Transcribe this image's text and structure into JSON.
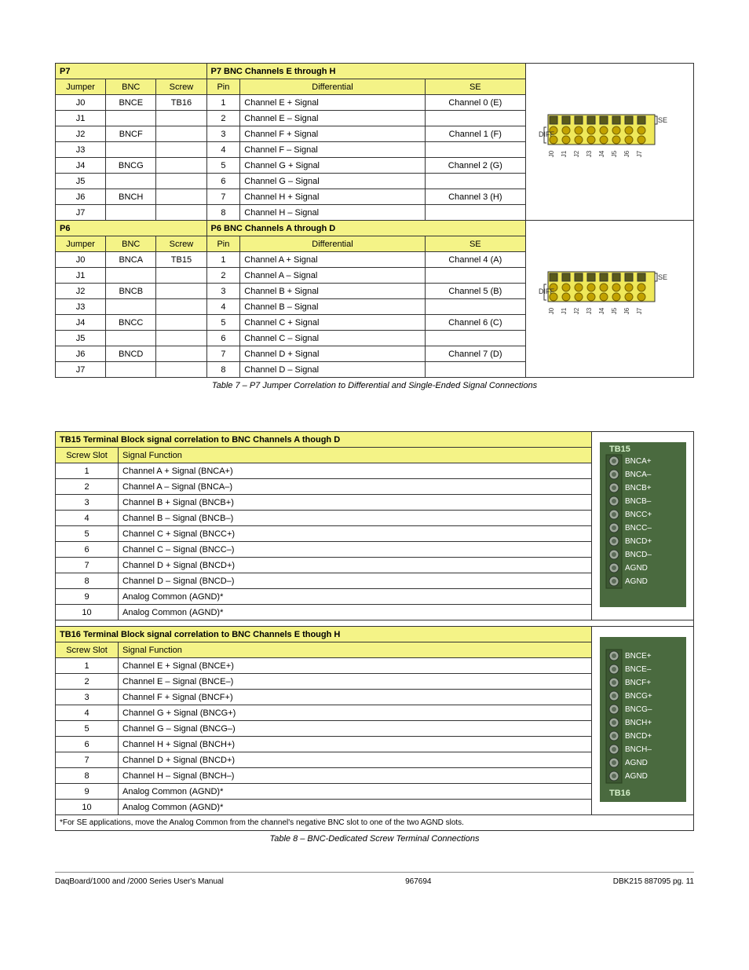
{
  "tables": {
    "p7": {
      "caption": "Table 7 – P7 Jumper Correlation to Differential and Single-Ended Signal Connections",
      "sections": [
        {
          "block_hdr": "P7 BNC Channels E through H",
          "cols": [
            "Jumper",
            "BNC",
            "Screw",
            "Pin",
            "Differential",
            "SE"
          ],
          "rows": [
            [
              "J0",
              "BNCE",
              "TB16",
              "1",
              "Channel E + Signal",
              "Channel 0 (E)"
            ],
            [
              "J1",
              "",
              "",
              "2",
              "Channel E – Signal",
              ""
            ],
            [
              "J2",
              "BNCF",
              "",
              "3",
              "Channel F + Signal",
              "Channel 1 (F)"
            ],
            [
              "J3",
              "",
              "",
              "4",
              "Channel F – Signal",
              ""
            ],
            [
              "J4",
              "BNCG",
              "",
              "5",
              "Channel G + Signal",
              "Channel 2 (G)"
            ],
            [
              "J5",
              "",
              "",
              "6",
              "Channel G – Signal",
              ""
            ],
            [
              "J6",
              "BNCH",
              "",
              "7",
              "Channel H + Signal",
              "Channel 3 (H)"
            ],
            [
              "J7",
              "",
              "",
              "8",
              "Channel H – Signal",
              ""
            ]
          ],
          "image_label": "P7"
        },
        {
          "block_hdr": "P6 BNC Channels A through D",
          "cols": [
            "Jumper",
            "BNC",
            "Screw",
            "Pin",
            "Differential",
            "SE"
          ],
          "rows": [
            [
              "J0",
              "BNCA",
              "TB15",
              "1",
              "Channel A + Signal",
              "Channel 4 (A)"
            ],
            [
              "J1",
              "",
              "",
              "2",
              "Channel A – Signal",
              ""
            ],
            [
              "J2",
              "BNCB",
              "",
              "3",
              "Channel B + Signal",
              "Channel 5 (B)"
            ],
            [
              "J3",
              "",
              "",
              "4",
              "Channel B – Signal",
              ""
            ],
            [
              "J4",
              "BNCC",
              "",
              "5",
              "Channel C + Signal",
              "Channel 6 (C)"
            ],
            [
              "J5",
              "",
              "",
              "6",
              "Channel C – Signal",
              ""
            ],
            [
              "J6",
              "BNCD",
              "",
              "7",
              "Channel D + Signal",
              "Channel 7 (D)"
            ],
            [
              "J7",
              "",
              "",
              "8",
              "Channel D – Signal",
              ""
            ]
          ],
          "image_label": "P6"
        }
      ]
    },
    "tb": {
      "caption": "Table 8 – BNC-Dedicated Screw Terminal Connections",
      "sections": [
        {
          "block_hdr": "TB15 Terminal Block signal correlation to BNC Channels A though D",
          "cols": [
            "Screw Slot",
            "Signal Function"
          ],
          "rows": [
            [
              "1",
              "Channel A + Signal (BNCA+)"
            ],
            [
              "2",
              "Channel A – Signal (BNCA–)"
            ],
            [
              "3",
              "Channel B + Signal (BNCB+)"
            ],
            [
              "4",
              "Channel B – Signal (BNCB–)"
            ],
            [
              "5",
              "Channel C + Signal (BNCC+)"
            ],
            [
              "6",
              "Channel C – Signal (BNCC–)"
            ],
            [
              "7",
              "Channel D + Signal (BNCD+)"
            ],
            [
              "8",
              "Channel D – Signal (BNCD–)"
            ],
            [
              "9",
              "Analog Common (AGND)*"
            ],
            [
              "10",
              "Analog Common (AGND)*"
            ]
          ],
          "tb_label": "TB15",
          "pins": [
            "BNCA+",
            "BNCA–",
            "BNCB+",
            "BNCB–",
            "BNCC+",
            "BNCC–",
            "BNCD+",
            "BNCD–",
            "AGND",
            "AGND"
          ]
        },
        {
          "block_hdr": "TB16 Terminal Block signal correlation to BNC Channels E though H",
          "cols": [
            "Screw Slot",
            "Signal Function"
          ],
          "rows": [
            [
              "1",
              "Channel E + Signal (BNCE+)"
            ],
            [
              "2",
              "Channel E – Signal (BNCE–)"
            ],
            [
              "3",
              "Channel F + Signal (BNCF+)"
            ],
            [
              "4",
              "Channel G + Signal (BNCG+)"
            ],
            [
              "5",
              "Channel G – Signal (BNCG–)"
            ],
            [
              "6",
              "Channel H + Signal (BNCH+)"
            ],
            [
              "7",
              "Channel D + Signal (BNCD+)"
            ],
            [
              "8",
              "Channel H – Signal (BNCH–)"
            ],
            [
              "9",
              "Analog Common (AGND)*"
            ],
            [
              "10",
              "Analog Common (AGND)*"
            ]
          ],
          "tb_label": "TB16",
          "pins": [
            "BNCE+",
            "BNCE–",
            "BNCF+",
            "BNCG+",
            "BNCG–",
            "BNCH+",
            "BNCD+",
            "BNCH–",
            "AGND",
            "AGND"
          ]
        }
      ],
      "footnote": "*For SE applications, move the Analog Common from the channel's negative BNC slot to one of the two AGND slots."
    }
  },
  "footer": {
    "left": "DaqBoard/1000 and /2000 Series User's Manual",
    "center": "967694",
    "right": "DBK215     887095      pg. 11"
  },
  "jumper_svg": {
    "diff_label": "DIFF",
    "se_label": "SE",
    "jlabels": [
      "J0",
      "J1",
      "J2",
      "J3",
      "J4",
      "J5",
      "J6",
      "J7"
    ]
  }
}
